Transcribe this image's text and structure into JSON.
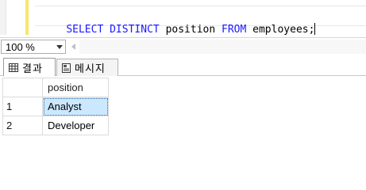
{
  "editor": {
    "tokens": [
      {
        "text": "SELECT",
        "kind": "keyword"
      },
      {
        "text": " ",
        "kind": "space"
      },
      {
        "text": "DISTINCT",
        "kind": "keyword"
      },
      {
        "text": " ",
        "kind": "space"
      },
      {
        "text": "position",
        "kind": "identifier"
      },
      {
        "text": " ",
        "kind": "space"
      },
      {
        "text": "FROM",
        "kind": "keyword"
      },
      {
        "text": " ",
        "kind": "space"
      },
      {
        "text": "employees;",
        "kind": "identifier"
      }
    ],
    "keyword_color": "#1a1aff"
  },
  "zoom": {
    "value": "100 %"
  },
  "tabs": {
    "results_label": "결과",
    "messages_label": "메시지"
  },
  "grid": {
    "columns": [
      "position"
    ],
    "rows": [
      {
        "num": "1",
        "position": "Analyst"
      },
      {
        "num": "2",
        "position": "Developer"
      }
    ],
    "selection_color": "#cce8ff"
  }
}
